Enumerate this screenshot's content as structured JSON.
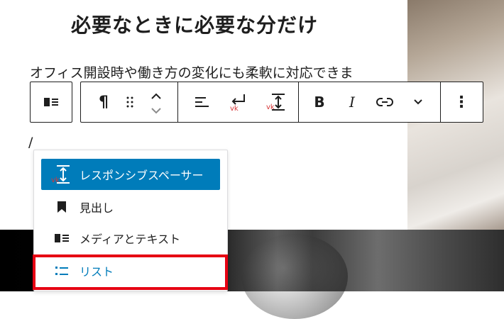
{
  "content": {
    "heading": "必要なときに必要な分だけ",
    "paragraph": "オフィス開設時や働き方の変化にも柔軟に対応できま",
    "slash_text": "/"
  },
  "toolbar": {
    "block_type_icon": "media-text-icon",
    "buttons": [
      {
        "name": "paragraph-icon",
        "glyph": "¶"
      },
      {
        "name": "drag-handle-icon",
        "glyph": "⠿"
      },
      {
        "name": "move-up-icon",
        "glyph": "⌃"
      },
      {
        "name": "move-down-icon",
        "glyph": "⌄"
      },
      {
        "name": "align-left-icon",
        "glyph": ""
      },
      {
        "name": "line-break-icon",
        "glyph": ""
      },
      {
        "name": "spacer-icon",
        "glyph": ""
      },
      {
        "name": "bold-icon",
        "glyph": "B"
      },
      {
        "name": "italic-icon",
        "glyph": "I"
      },
      {
        "name": "link-icon",
        "glyph": ""
      },
      {
        "name": "chevron-down-icon",
        "glyph": ""
      },
      {
        "name": "more-options-icon",
        "glyph": "⋮"
      }
    ]
  },
  "slash_menu": {
    "items": [
      {
        "label": "レスポンシブスペーサー",
        "icon": "responsive-spacer-icon",
        "state": "selected"
      },
      {
        "label": "見出し",
        "icon": "bookmark-icon",
        "state": "normal"
      },
      {
        "label": "メディアとテキスト",
        "icon": "media-text-icon",
        "state": "normal"
      },
      {
        "label": "リスト",
        "icon": "list-icon",
        "state": "highlighted"
      }
    ]
  },
  "colors": {
    "accent": "#007cba",
    "highlight": "#e60012",
    "text": "#1e1e1e"
  }
}
